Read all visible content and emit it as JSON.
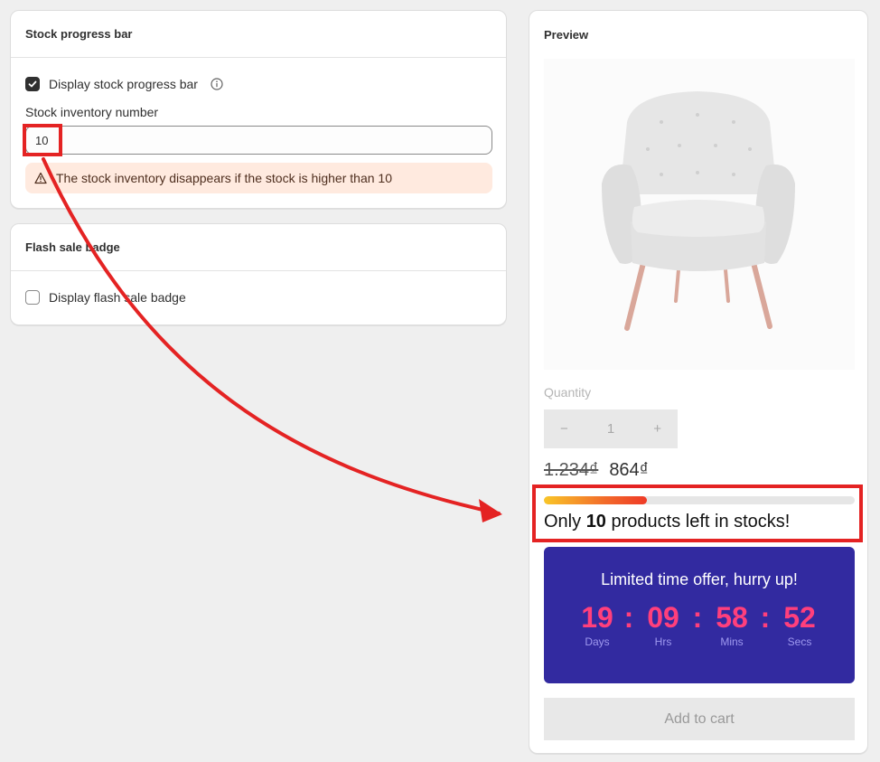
{
  "stock_card": {
    "title": "Stock progress bar",
    "display_checkbox_label": "Display stock progress bar",
    "display_checked": true,
    "inventory_label": "Stock inventory number",
    "inventory_value": "10",
    "warning_text": "The stock inventory disappears if the stock is higher than 10"
  },
  "flash_card": {
    "title": "Flash sale badge",
    "checkbox_label": "Display flash sale badge",
    "checked": false
  },
  "preview": {
    "title": "Preview",
    "product_image": "armchair",
    "quantity_label": "Quantity",
    "quantity_minus": "−",
    "quantity_value": "1",
    "quantity_plus": "+",
    "price_original": "1.234₫",
    "price_sale": "864₫",
    "stock_progress": 0.33,
    "stock_text_prefix": "Only",
    "stock_count": "10",
    "stock_text_suffix": "products left in stocks!",
    "countdown": {
      "title": "Limited time offer, hurry up!",
      "separator": ":",
      "units": [
        {
          "value": "19",
          "label": "Days"
        },
        {
          "value": "09",
          "label": "Hrs"
        },
        {
          "value": "58",
          "label": "Mins"
        },
        {
          "value": "52",
          "label": "Secs"
        }
      ]
    },
    "add_to_cart": "Add to cart"
  },
  "colors": {
    "highlight": "#e42323",
    "countdown_bg": "#322aa0",
    "countdown_digits": "#ff3f7c",
    "warning_bg": "#ffeadf"
  }
}
